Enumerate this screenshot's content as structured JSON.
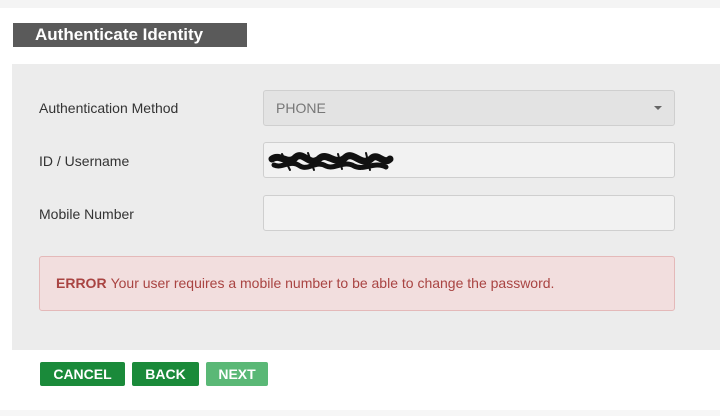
{
  "header": {
    "title": "Authenticate Identity"
  },
  "form": {
    "auth_method": {
      "label": "Authentication Method",
      "value": "PHONE"
    },
    "username": {
      "label": "ID / Username",
      "value": "",
      "redacted": true
    },
    "mobile": {
      "label": "Mobile Number",
      "value": ""
    }
  },
  "alert": {
    "prefix": "ERROR",
    "message": "Your user requires a mobile number to be able to change the password."
  },
  "buttons": {
    "cancel": "CANCEL",
    "back": "BACK",
    "next": "NEXT"
  },
  "colors": {
    "header_bg": "#5a5a5a",
    "panel_bg": "#ececec",
    "alert_bg": "#f2dede",
    "alert_text": "#a94442",
    "button_green": "#1a8a3a",
    "button_green_disabled": "#5ab876"
  }
}
